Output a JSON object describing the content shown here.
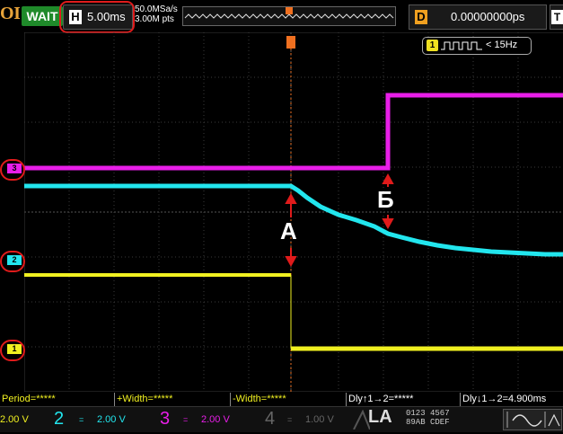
{
  "header": {
    "brand": "OL",
    "run_state": "WAIT",
    "horizontal_label": "H",
    "horizontal_scale": "5.00ms",
    "sample_rate": "50.0MSa/s",
    "memory_depth": "3.00M pts",
    "delay_label": "D",
    "delay_value": "0.00000000ps",
    "trigger_label": "T"
  },
  "trigger_badge": {
    "channel": "1",
    "frequency": "< 15Hz"
  },
  "channel_markers": {
    "ch3": "3",
    "ch2": "2",
    "ch1": "1"
  },
  "annotations": {
    "a": "А",
    "b": "Б"
  },
  "measurements": {
    "period": "Period=*****",
    "pos_width": "+Width=*****",
    "neg_width": "-Width=*****",
    "delay_rise": "Dly↑1→2=*****",
    "delay_fall": "Dly↓1→2=4.900ms"
  },
  "bottom": {
    "ch1_scale": "2.00 V",
    "ch2_num": "2",
    "ch2_scale": "2.00 V",
    "ch3_num": "3",
    "ch3_scale": "2.00 V",
    "ch4_num": "4",
    "ch4_scale": "1.00 V",
    "la_label": "LA",
    "la_row1": "0123 4567",
    "la_row2": "89AB CDEF"
  },
  "colors": {
    "ch1": "#f0f020",
    "ch2": "#22e6ee",
    "ch3": "#e81ee8",
    "ch4": "#3050f0",
    "annotation_marker": "#e01b1b"
  }
}
